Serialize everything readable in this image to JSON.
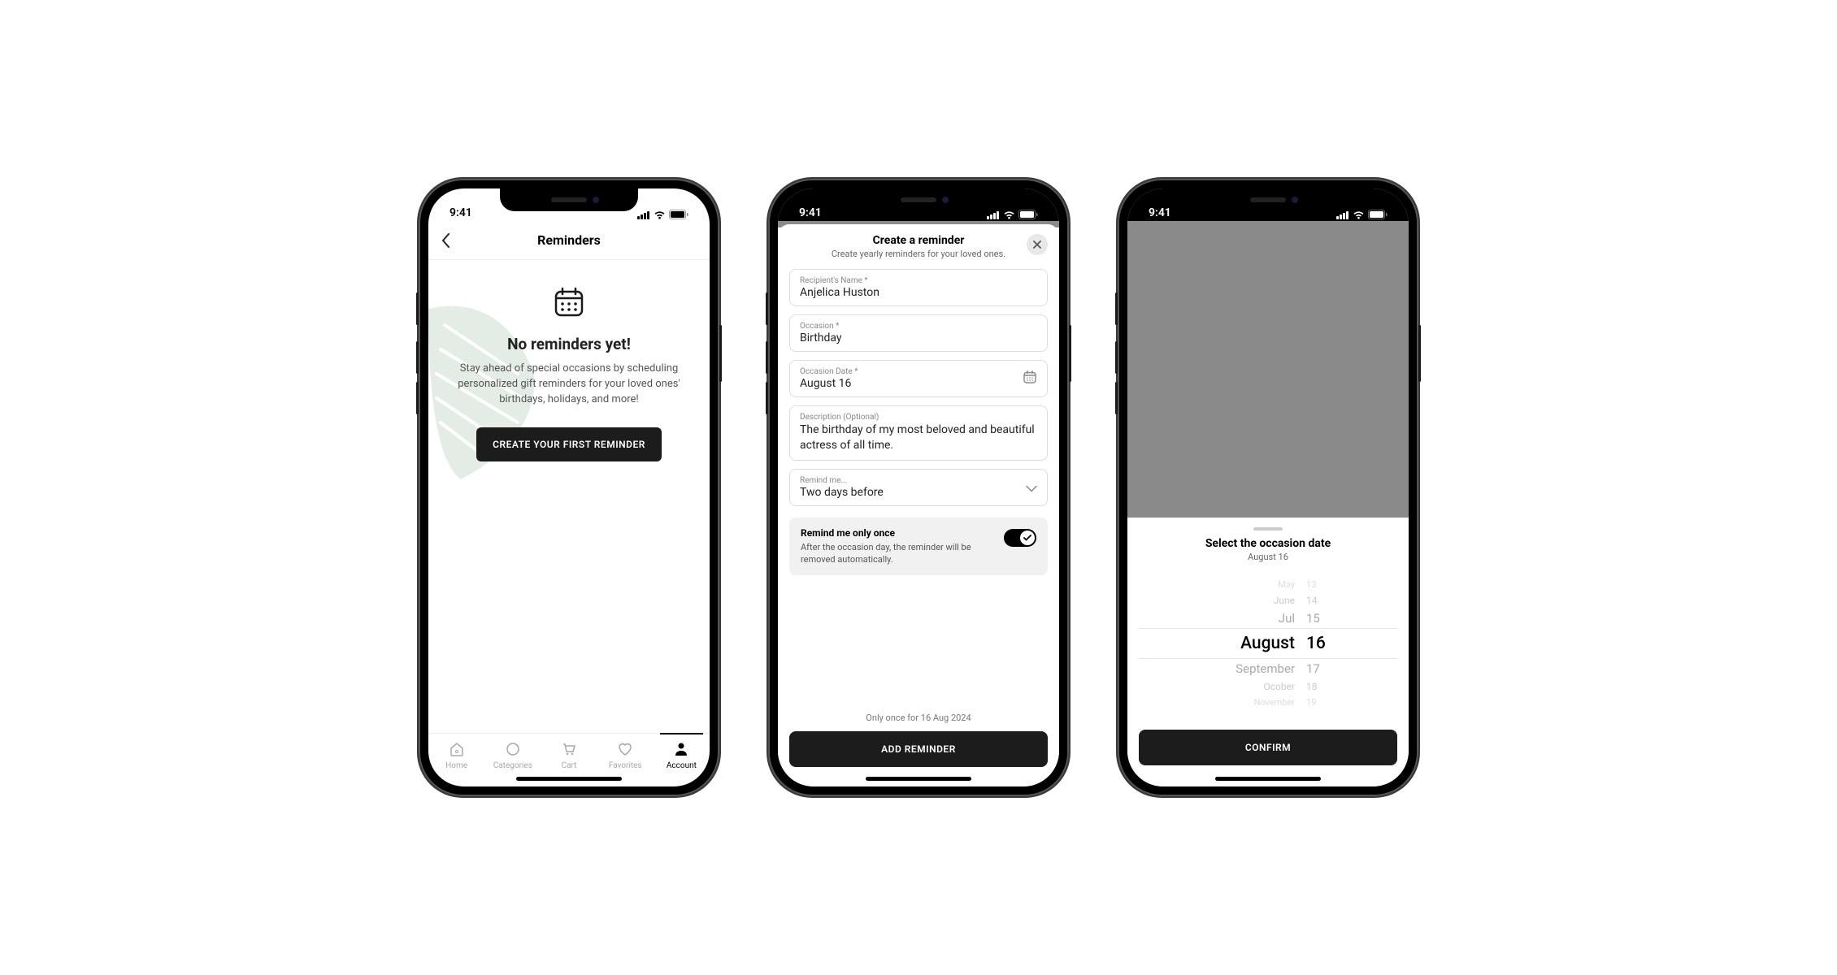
{
  "status": {
    "time": "9:41"
  },
  "screen1": {
    "title": "Reminders",
    "empty_title": "No reminders yet!",
    "empty_desc": "Stay ahead of special occasions by scheduling personalized gift reminders for your loved ones' birthdays, holidays, and more!",
    "cta": "CREATE YOUR FIRST REMINDER",
    "tabs": {
      "home": "Home",
      "categories": "Categories",
      "cart": "Cart",
      "favorites": "Favorites",
      "account": "Account"
    }
  },
  "screen2": {
    "title": "Create a reminder",
    "subtitle": "Create yearly reminders for your loved ones.",
    "fields": {
      "name_label": "Recipient's Name *",
      "name_value": "Anjelica Huston",
      "occasion_label": "Occasion *",
      "occasion_value": "Birthday",
      "date_label": "Occasion Date *",
      "date_value": "August 16",
      "desc_label": "Description (Optional)",
      "desc_value": "The birthday of my most beloved and beautiful actress of all time.",
      "remind_label": "Remind me...",
      "remind_value": "Two days before"
    },
    "once": {
      "title": "Remind me only once",
      "desc": "After the occasion day, the reminder will be removed automatically."
    },
    "caption": "Only once for 16 Aug 2024",
    "submit": "ADD REMINDER"
  },
  "screen3": {
    "title": "Select the occasion date",
    "subtitle": "August 16",
    "picker": {
      "months": [
        "May",
        "June",
        "Jul",
        "August",
        "September",
        "Ocober",
        "November"
      ],
      "days": [
        "13",
        "14",
        "15",
        "16",
        "17",
        "18",
        "19"
      ]
    },
    "confirm": "CONFIRM"
  }
}
